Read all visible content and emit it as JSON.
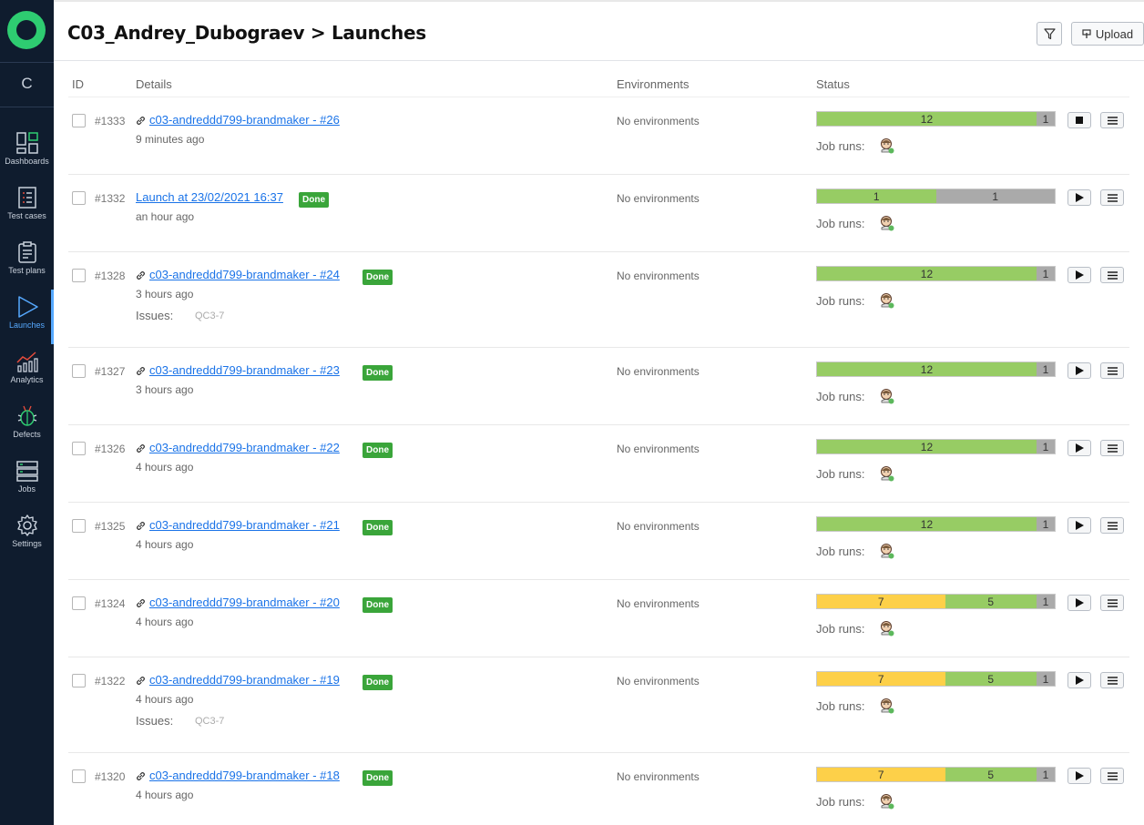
{
  "sidebar": {
    "project_letter": "C",
    "items": [
      {
        "label": "Dashboards",
        "icon": "dashboards-icon"
      },
      {
        "label": "Test cases",
        "icon": "test-cases-icon"
      },
      {
        "label": "Test plans",
        "icon": "test-plans-icon"
      },
      {
        "label": "Launches",
        "icon": "launches-icon",
        "active": true
      },
      {
        "label": "Analytics",
        "icon": "analytics-icon"
      },
      {
        "label": "Defects",
        "icon": "bug-icon"
      },
      {
        "label": "Jobs",
        "icon": "jobs-icon"
      },
      {
        "label": "Settings",
        "icon": "gear-icon"
      }
    ]
  },
  "header": {
    "title": "C03_Andrey_Dubograev > Launches",
    "upload_label": "Upload"
  },
  "table": {
    "columns": [
      "ID",
      "Details",
      "Environments",
      "Status"
    ],
    "job_runs_label": "Job runs:",
    "issues_label": "Issues:",
    "rows": [
      {
        "id": "#1333",
        "name": "c03-andreddd799-brandmaker - #26",
        "linked": true,
        "badge": "",
        "time": "9 minutes ago",
        "issues": "",
        "env": "No environments",
        "action": "stop",
        "segments": [
          {
            "value": "12",
            "color": "#97cc64"
          },
          {
            "value": "1",
            "color": "#aaaaaa"
          }
        ]
      },
      {
        "id": "#1332",
        "name": "Launch at 23/02/2021 16:37",
        "linked": false,
        "badge": "Done",
        "time": "an hour ago",
        "issues": "",
        "env": "No environments",
        "action": "play",
        "segments": [
          {
            "value": "1",
            "color": "#97cc64"
          },
          {
            "value": "1",
            "color": "#aaaaaa"
          }
        ]
      },
      {
        "id": "#1328",
        "name": "c03-andreddd799-brandmaker - #24",
        "linked": true,
        "badge": "Done",
        "time": "3 hours ago",
        "issues": "QC3-7",
        "env": "No environments",
        "action": "play",
        "segments": [
          {
            "value": "12",
            "color": "#97cc64"
          },
          {
            "value": "1",
            "color": "#aaaaaa"
          }
        ]
      },
      {
        "id": "#1327",
        "name": "c03-andreddd799-brandmaker - #23",
        "linked": true,
        "badge": "Done",
        "time": "3 hours ago",
        "issues": "",
        "env": "No environments",
        "action": "play",
        "segments": [
          {
            "value": "12",
            "color": "#97cc64"
          },
          {
            "value": "1",
            "color": "#aaaaaa"
          }
        ]
      },
      {
        "id": "#1326",
        "name": "c03-andreddd799-brandmaker - #22",
        "linked": true,
        "badge": "Done",
        "time": "4 hours ago",
        "issues": "",
        "env": "No environments",
        "action": "play",
        "segments": [
          {
            "value": "12",
            "color": "#97cc64"
          },
          {
            "value": "1",
            "color": "#aaaaaa"
          }
        ]
      },
      {
        "id": "#1325",
        "name": "c03-andreddd799-brandmaker - #21",
        "linked": true,
        "badge": "Done",
        "time": "4 hours ago",
        "issues": "",
        "env": "No environments",
        "action": "play",
        "segments": [
          {
            "value": "12",
            "color": "#97cc64"
          },
          {
            "value": "1",
            "color": "#aaaaaa"
          }
        ]
      },
      {
        "id": "#1324",
        "name": "c03-andreddd799-brandmaker - #20",
        "linked": true,
        "badge": "Done",
        "time": "4 hours ago",
        "issues": "",
        "env": "No environments",
        "action": "play",
        "segments": [
          {
            "value": "7",
            "color": "#fdd049"
          },
          {
            "value": "5",
            "color": "#97cc64"
          },
          {
            "value": "1",
            "color": "#aaaaaa"
          }
        ]
      },
      {
        "id": "#1322",
        "name": "c03-andreddd799-brandmaker - #19",
        "linked": true,
        "badge": "Done",
        "time": "4 hours ago",
        "issues": "QC3-7",
        "env": "No environments",
        "action": "play",
        "segments": [
          {
            "value": "7",
            "color": "#fdd049"
          },
          {
            "value": "5",
            "color": "#97cc64"
          },
          {
            "value": "1",
            "color": "#aaaaaa"
          }
        ]
      },
      {
        "id": "#1320",
        "name": "c03-andreddd799-brandmaker - #18",
        "linked": true,
        "badge": "Done",
        "time": "4 hours ago",
        "issues": "",
        "env": "No environments",
        "action": "play",
        "segments": [
          {
            "value": "7",
            "color": "#fdd049"
          },
          {
            "value": "5",
            "color": "#97cc64"
          },
          {
            "value": "1",
            "color": "#aaaaaa"
          }
        ]
      }
    ]
  }
}
